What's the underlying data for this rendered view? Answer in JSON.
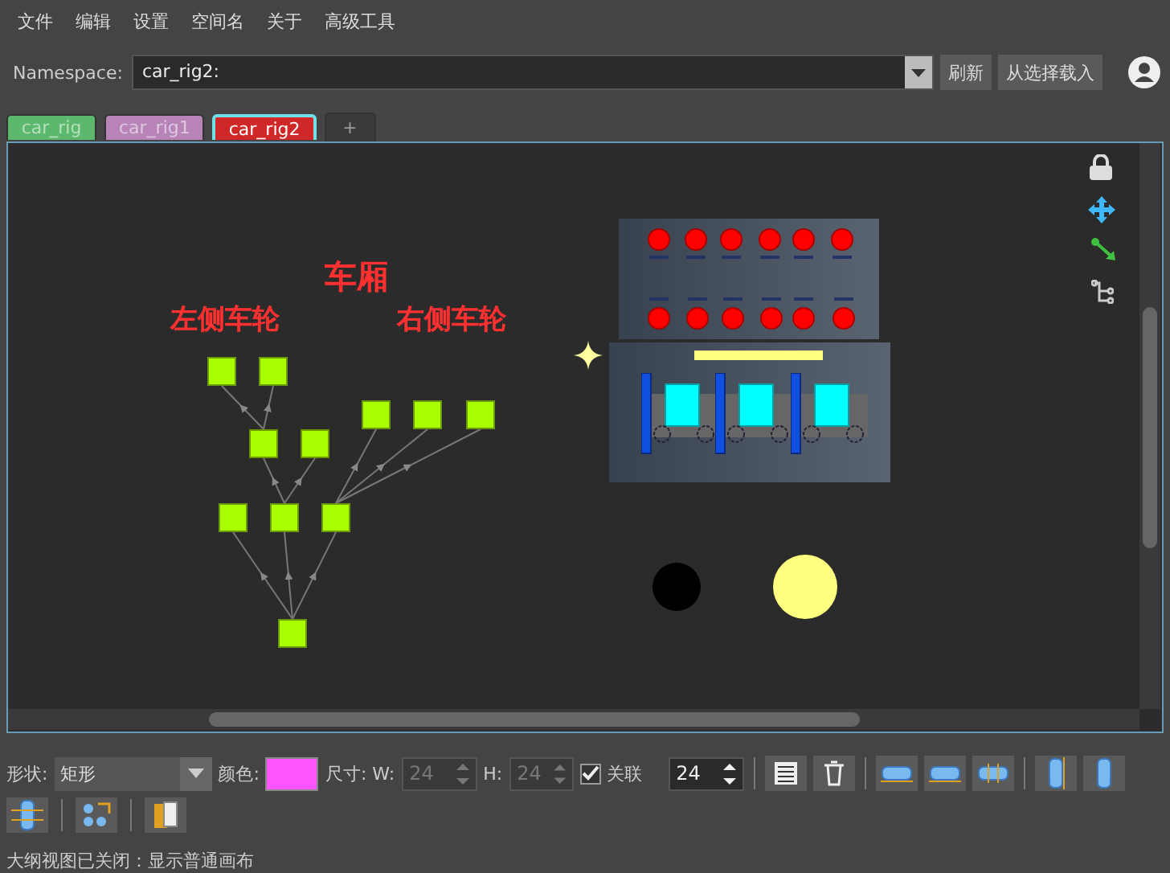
{
  "menu": [
    "文件",
    "编辑",
    "设置",
    "空间名",
    "关于",
    "高级工具"
  ],
  "namespace": {
    "label": "Namespace:",
    "value": "car_rig2:"
  },
  "buttons": [
    "刷新",
    "从选择载入"
  ],
  "tabs": [
    {
      "kind": "rig",
      "label": "car_rig",
      "color": "#5cb86c",
      "selected": false
    },
    {
      "kind": "rig",
      "label": "car_rig1",
      "color": "#b884b8",
      "selected": false
    },
    {
      "kind": "rig",
      "label": "car_rig2",
      "color": "#d02828",
      "selected": true
    },
    {
      "kind": "add",
      "label": "+",
      "selected": false
    }
  ],
  "canvas": {
    "labels": [
      "车厢",
      "左侧车轮",
      "右侧车轮"
    ]
  },
  "toolbar": {
    "shape_label": "形状:",
    "shape_value": "矩形",
    "color_label": "颜色:",
    "color": "#ff55ff",
    "size_label": "尺寸:",
    "w_label": "W:",
    "w_value": "24",
    "w_disabled": true,
    "h_label": "H:",
    "h_value": "24",
    "h_disabled": true,
    "link_checked": true,
    "link_label": "关联",
    "link_value": "24"
  },
  "status_bar": "大纲视图已关闭：显示普通画布"
}
